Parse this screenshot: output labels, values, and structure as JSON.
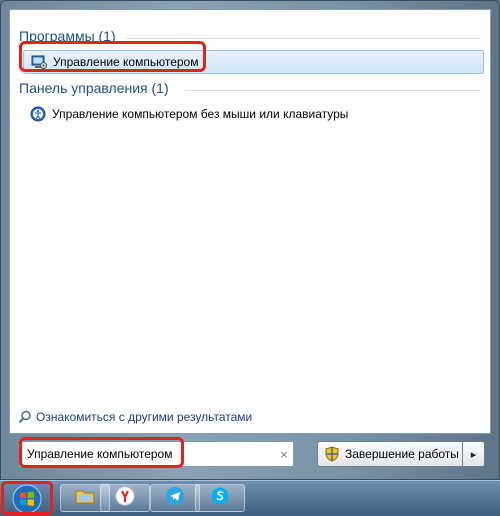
{
  "results": {
    "programs": {
      "header": "Программы (1)",
      "items": [
        {
          "label": "Управление компьютером",
          "icon": "computer-management-icon"
        }
      ]
    },
    "control_panel": {
      "header": "Панель управления (1)",
      "items": [
        {
          "label": "Управление компьютером без мыши или клавиатуры",
          "icon": "ease-of-access-icon"
        }
      ]
    },
    "more_results_label": "Ознакомиться с другими результатами"
  },
  "search": {
    "value": "Управление компьютером",
    "clear_icon": "×"
  },
  "shutdown": {
    "label": "Завершение работы",
    "arrow": "▸"
  },
  "taskbar": {
    "apps": [
      "windows-start-orb",
      "file-explorer-icon",
      "yandex-browser-icon",
      "telegram-icon",
      "skype-icon"
    ]
  },
  "colors": {
    "header_text": "#1e4f8c",
    "link_text": "#1b3b8f",
    "highlight": "#e2231a",
    "selection_bg": "#d0e6fb"
  }
}
